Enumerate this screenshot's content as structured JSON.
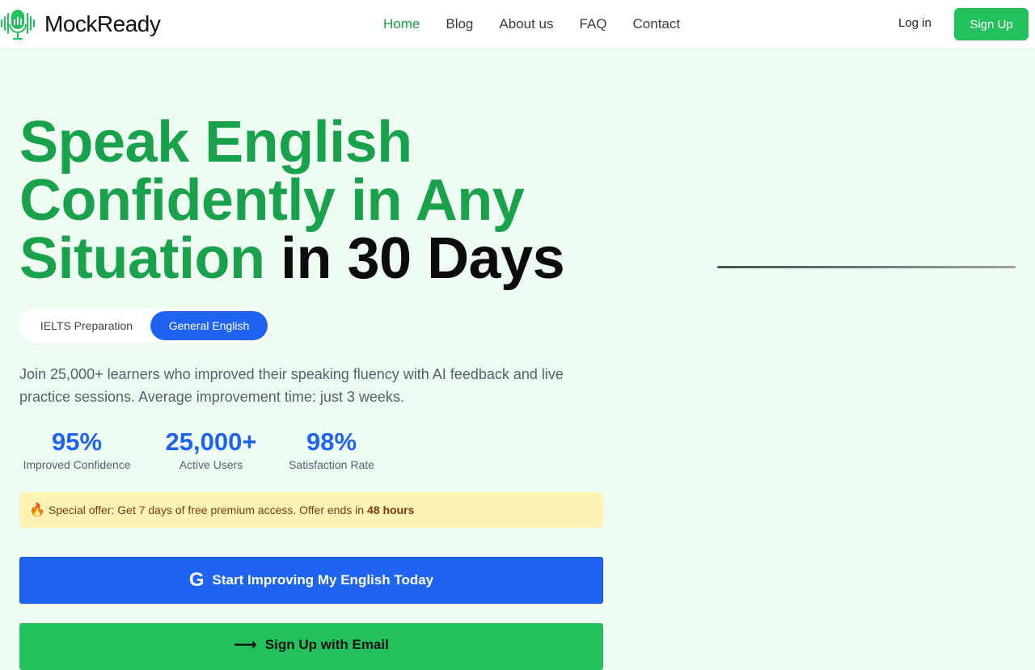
{
  "nav": {
    "logo_text": "MockReady",
    "links": [
      "Home",
      "Blog",
      "About us",
      "FAQ",
      "Contact"
    ],
    "active": "Home",
    "login_label": "Log in",
    "signup_label": "Sign Up"
  },
  "hero": {
    "title_green_1": "Speak English",
    "title_green_2": "Confidently in Any",
    "title_green_3": "Situation",
    "title_dark": "in 30 Days",
    "toggle": {
      "ielts_label": "IELTS Preparation",
      "general_label": "General English",
      "selected": "General English"
    },
    "subtitle": "Join 25,000+ learners who improved their speaking fluency with AI feedback and live practice sessions. Average improvement time: just 3 weeks.",
    "stats": [
      {
        "value": "95%",
        "label": "Improved Confidence"
      },
      {
        "value": "25,000+",
        "label": "Active Users"
      },
      {
        "value": "98%",
        "label": "Satisfaction Rate"
      }
    ],
    "offer": {
      "icon": "fire-icon",
      "text": "Special offer: Get 7 days of free premium access. Offer ends in",
      "highlight": "48 hours"
    },
    "cta_google_label": "Start Improving My English Today",
    "cta_email_label": "Sign Up with Email"
  },
  "colors": {
    "brand_green": "#1aa14c",
    "button_green": "#22c15e",
    "accent_blue": "#1e64f0",
    "background": "#effcf2",
    "offer_bg": "#fdf3b3"
  }
}
